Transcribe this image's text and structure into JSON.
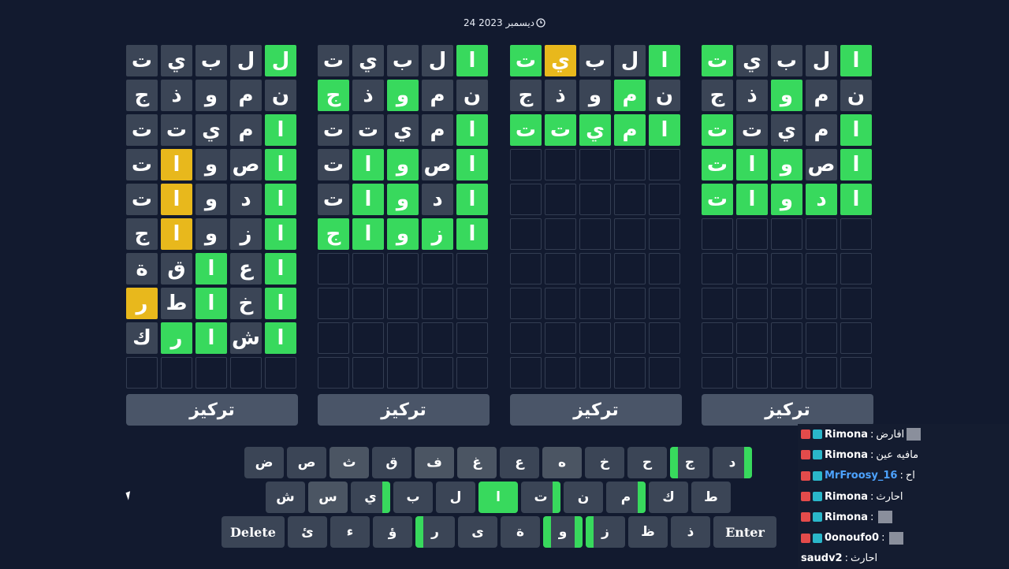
{
  "header": {
    "date": "24 ديسمبر 2023",
    "clock_icon": "clock-icon"
  },
  "focus_label": "تركيز",
  "boards": [
    {
      "rows": [
        [
          [
            "ل",
            "correct"
          ],
          [
            "ل",
            "absent"
          ],
          [
            "ب",
            "absent"
          ],
          [
            "ي",
            "absent"
          ],
          [
            "ت",
            "absent"
          ]
        ],
        [
          [
            "ن",
            "absent"
          ],
          [
            "م",
            "absent"
          ],
          [
            "و",
            "absent"
          ],
          [
            "ذ",
            "absent"
          ],
          [
            "ج",
            "absent"
          ]
        ],
        [
          [
            "ا",
            "correct"
          ],
          [
            "م",
            "absent"
          ],
          [
            "ي",
            "absent"
          ],
          [
            "ت",
            "absent"
          ],
          [
            "ت",
            "absent"
          ]
        ],
        [
          [
            "ا",
            "correct"
          ],
          [
            "ص",
            "absent"
          ],
          [
            "و",
            "absent"
          ],
          [
            "ا",
            "present"
          ],
          [
            "ت",
            "absent"
          ]
        ],
        [
          [
            "ا",
            "correct"
          ],
          [
            "د",
            "absent"
          ],
          [
            "و",
            "absent"
          ],
          [
            "ا",
            "present"
          ],
          [
            "ت",
            "absent"
          ]
        ],
        [
          [
            "ا",
            "correct"
          ],
          [
            "ز",
            "absent"
          ],
          [
            "و",
            "absent"
          ],
          [
            "ا",
            "present"
          ],
          [
            "ج",
            "absent"
          ]
        ],
        [
          [
            "ا",
            "correct"
          ],
          [
            "ع",
            "absent"
          ],
          [
            "ا",
            "correct"
          ],
          [
            "ق",
            "absent"
          ],
          [
            "ة",
            "absent"
          ]
        ],
        [
          [
            "ا",
            "correct"
          ],
          [
            "خ",
            "absent"
          ],
          [
            "ا",
            "correct"
          ],
          [
            "ط",
            "absent"
          ],
          [
            "ر",
            "present"
          ]
        ],
        [
          [
            "ا",
            "correct"
          ],
          [
            "ش",
            "absent"
          ],
          [
            "ا",
            "correct"
          ],
          [
            "ر",
            "correct"
          ],
          [
            "ك",
            "absent"
          ]
        ],
        [
          [
            "",
            ""
          ],
          [
            "",
            ""
          ],
          [
            "",
            ""
          ],
          [
            "",
            ""
          ],
          [
            "",
            ""
          ]
        ]
      ]
    },
    {
      "rows": [
        [
          [
            "ا",
            "correct"
          ],
          [
            "ل",
            "absent"
          ],
          [
            "ب",
            "absent"
          ],
          [
            "ي",
            "absent"
          ],
          [
            "ت",
            "absent"
          ]
        ],
        [
          [
            "ن",
            "absent"
          ],
          [
            "م",
            "absent"
          ],
          [
            "و",
            "correct"
          ],
          [
            "ذ",
            "absent"
          ],
          [
            "ج",
            "correct"
          ]
        ],
        [
          [
            "ا",
            "correct"
          ],
          [
            "م",
            "absent"
          ],
          [
            "ي",
            "absent"
          ],
          [
            "ت",
            "absent"
          ],
          [
            "ت",
            "absent"
          ]
        ],
        [
          [
            "ا",
            "correct"
          ],
          [
            "ص",
            "absent"
          ],
          [
            "و",
            "correct"
          ],
          [
            "ا",
            "correct"
          ],
          [
            "ت",
            "absent"
          ]
        ],
        [
          [
            "ا",
            "correct"
          ],
          [
            "د",
            "absent"
          ],
          [
            "و",
            "correct"
          ],
          [
            "ا",
            "correct"
          ],
          [
            "ت",
            "absent"
          ]
        ],
        [
          [
            "ا",
            "correct"
          ],
          [
            "ز",
            "correct"
          ],
          [
            "و",
            "correct"
          ],
          [
            "ا",
            "correct"
          ],
          [
            "ج",
            "correct"
          ]
        ],
        [
          [
            "",
            ""
          ],
          [
            "",
            ""
          ],
          [
            "",
            ""
          ],
          [
            "",
            ""
          ],
          [
            "",
            ""
          ]
        ],
        [
          [
            "",
            ""
          ],
          [
            "",
            ""
          ],
          [
            "",
            ""
          ],
          [
            "",
            ""
          ],
          [
            "",
            ""
          ]
        ],
        [
          [
            "",
            ""
          ],
          [
            "",
            ""
          ],
          [
            "",
            ""
          ],
          [
            "",
            ""
          ],
          [
            "",
            ""
          ]
        ],
        [
          [
            "",
            ""
          ],
          [
            "",
            ""
          ],
          [
            "",
            ""
          ],
          [
            "",
            ""
          ],
          [
            "",
            ""
          ]
        ]
      ]
    },
    {
      "rows": [
        [
          [
            "ا",
            "correct"
          ],
          [
            "ل",
            "absent"
          ],
          [
            "ب",
            "absent"
          ],
          [
            "ي",
            "present"
          ],
          [
            "ت",
            "correct"
          ]
        ],
        [
          [
            "ن",
            "absent"
          ],
          [
            "م",
            "correct"
          ],
          [
            "و",
            "absent"
          ],
          [
            "ذ",
            "absent"
          ],
          [
            "ج",
            "absent"
          ]
        ],
        [
          [
            "ا",
            "correct"
          ],
          [
            "م",
            "correct"
          ],
          [
            "ي",
            "correct"
          ],
          [
            "ت",
            "correct"
          ],
          [
            "ت",
            "correct"
          ]
        ],
        [
          [
            "",
            ""
          ],
          [
            "",
            ""
          ],
          [
            "",
            ""
          ],
          [
            "",
            ""
          ],
          [
            "",
            ""
          ]
        ],
        [
          [
            "",
            ""
          ],
          [
            "",
            ""
          ],
          [
            "",
            ""
          ],
          [
            "",
            ""
          ],
          [
            "",
            ""
          ]
        ],
        [
          [
            "",
            ""
          ],
          [
            "",
            ""
          ],
          [
            "",
            ""
          ],
          [
            "",
            ""
          ],
          [
            "",
            ""
          ]
        ],
        [
          [
            "",
            ""
          ],
          [
            "",
            ""
          ],
          [
            "",
            ""
          ],
          [
            "",
            ""
          ],
          [
            "",
            ""
          ]
        ],
        [
          [
            "",
            ""
          ],
          [
            "",
            ""
          ],
          [
            "",
            ""
          ],
          [
            "",
            ""
          ],
          [
            "",
            ""
          ]
        ],
        [
          [
            "",
            ""
          ],
          [
            "",
            ""
          ],
          [
            "",
            ""
          ],
          [
            "",
            ""
          ],
          [
            "",
            ""
          ]
        ],
        [
          [
            "",
            ""
          ],
          [
            "",
            ""
          ],
          [
            "",
            ""
          ],
          [
            "",
            ""
          ],
          [
            "",
            ""
          ]
        ]
      ]
    },
    {
      "rows": [
        [
          [
            "ا",
            "correct"
          ],
          [
            "ل",
            "absent"
          ],
          [
            "ب",
            "absent"
          ],
          [
            "ي",
            "absent"
          ],
          [
            "ت",
            "correct"
          ]
        ],
        [
          [
            "ن",
            "absent"
          ],
          [
            "م",
            "absent"
          ],
          [
            "و",
            "correct"
          ],
          [
            "ذ",
            "absent"
          ],
          [
            "ج",
            "absent"
          ]
        ],
        [
          [
            "ا",
            "correct"
          ],
          [
            "م",
            "absent"
          ],
          [
            "ي",
            "absent"
          ],
          [
            "ت",
            "absent"
          ],
          [
            "ت",
            "correct"
          ]
        ],
        [
          [
            "ا",
            "correct"
          ],
          [
            "ص",
            "absent"
          ],
          [
            "و",
            "correct"
          ],
          [
            "ا",
            "correct"
          ],
          [
            "ت",
            "correct"
          ]
        ],
        [
          [
            "ا",
            "correct"
          ],
          [
            "د",
            "correct"
          ],
          [
            "و",
            "correct"
          ],
          [
            "ا",
            "correct"
          ],
          [
            "ت",
            "correct"
          ]
        ],
        [
          [
            "",
            ""
          ],
          [
            "",
            ""
          ],
          [
            "",
            ""
          ],
          [
            "",
            ""
          ],
          [
            "",
            ""
          ]
        ],
        [
          [
            "",
            ""
          ],
          [
            "",
            ""
          ],
          [
            "",
            ""
          ],
          [
            "",
            ""
          ],
          [
            "",
            ""
          ]
        ],
        [
          [
            "",
            ""
          ],
          [
            "",
            ""
          ],
          [
            "",
            ""
          ],
          [
            "",
            ""
          ],
          [
            "",
            ""
          ]
        ],
        [
          [
            "",
            ""
          ],
          [
            "",
            ""
          ],
          [
            "",
            ""
          ],
          [
            "",
            ""
          ],
          [
            "",
            ""
          ]
        ],
        [
          [
            "",
            ""
          ],
          [
            "",
            ""
          ],
          [
            "",
            ""
          ],
          [
            "",
            ""
          ],
          [
            "",
            ""
          ]
        ]
      ]
    }
  ],
  "keyboard": {
    "row1": [
      {
        "k": "ض",
        "s": "absent"
      },
      {
        "k": "ص",
        "s": "absent"
      },
      {
        "k": "ث",
        "s": "grey"
      },
      {
        "k": "ق",
        "s": "absent"
      },
      {
        "k": "ف",
        "s": "grey"
      },
      {
        "k": "غ",
        "s": "grey"
      },
      {
        "k": "ع",
        "s": "absent"
      },
      {
        "k": "ه",
        "s": "grey"
      },
      {
        "k": "خ",
        "s": "absent"
      },
      {
        "k": "ح",
        "s": "absent"
      },
      {
        "k": "ج",
        "s": "mark-left"
      },
      {
        "k": "د",
        "s": "mark-right"
      }
    ],
    "row2": [
      {
        "k": "ش",
        "s": "absent"
      },
      {
        "k": "س",
        "s": "grey"
      },
      {
        "k": "ي",
        "s": "mark-right"
      },
      {
        "k": "ب",
        "s": "absent"
      },
      {
        "k": "ل",
        "s": "absent"
      },
      {
        "k": "ا",
        "s": "green"
      },
      {
        "k": "ت",
        "s": "mark-right"
      },
      {
        "k": "ن",
        "s": "absent"
      },
      {
        "k": "م",
        "s": "mark-right"
      },
      {
        "k": "ك",
        "s": "absent"
      },
      {
        "k": "ط",
        "s": "absent"
      }
    ],
    "row3": [
      {
        "k": "Delete",
        "s": "wide"
      },
      {
        "k": "ئ",
        "s": "absent"
      },
      {
        "k": "ء",
        "s": "absent"
      },
      {
        "k": "ؤ",
        "s": "absent"
      },
      {
        "k": "ر",
        "s": "mark-left"
      },
      {
        "k": "ى",
        "s": "absent"
      },
      {
        "k": "ة",
        "s": "absent"
      },
      {
        "k": "و",
        "s": "mark-both"
      },
      {
        "k": "ز",
        "s": "mark-left"
      },
      {
        "k": "ظ",
        "s": "absent"
      },
      {
        "k": "ذ",
        "s": "absent"
      },
      {
        "k": "Enter",
        "s": "wide"
      }
    ]
  },
  "chat": [
    {
      "user": "Rimona",
      "msg": "افارض",
      "avatar": true
    },
    {
      "user": "Rimona",
      "msg": "مافيه عين",
      "avatar": false
    },
    {
      "user": "MrFroosy_16",
      "msg": "اح",
      "avatar": false
    },
    {
      "user": "Rimona",
      "msg": "احارث",
      "avatar": false
    },
    {
      "user": "Rimona",
      "msg": "",
      "avatar": true
    },
    {
      "user": "0onoufo0",
      "msg": "",
      "avatar": true
    },
    {
      "user": "saudv2",
      "msg": "احارث",
      "avatar": false
    }
  ]
}
